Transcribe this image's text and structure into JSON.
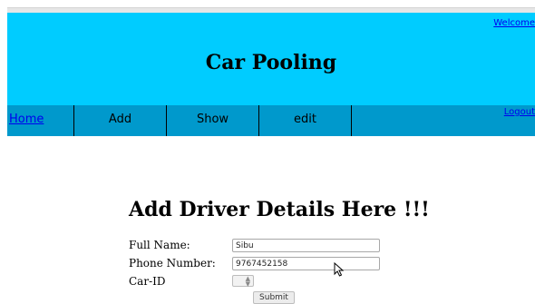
{
  "header": {
    "welcome_link": "Welcome",
    "title": "Car Pooling",
    "background_color": "#00ccff"
  },
  "nav": {
    "background_color": "#0099cc",
    "items": [
      {
        "label": "Home"
      },
      {
        "label": "Add"
      },
      {
        "label": "Show"
      },
      {
        "label": "edit"
      }
    ],
    "logout_link": "Logout"
  },
  "form": {
    "title": "Add Driver Details Here !!!",
    "fields": {
      "full_name": {
        "label": "Full Name:",
        "value": "Sibu"
      },
      "phone_number": {
        "label": "Phone Number:",
        "value": "9767452158"
      },
      "car_id": {
        "label": "Car-ID",
        "value": ""
      }
    },
    "submit_label": "Submit"
  },
  "icons": {
    "cursor": "mouse-pointer-icon",
    "spinner": "spinner-arrows-icon"
  }
}
